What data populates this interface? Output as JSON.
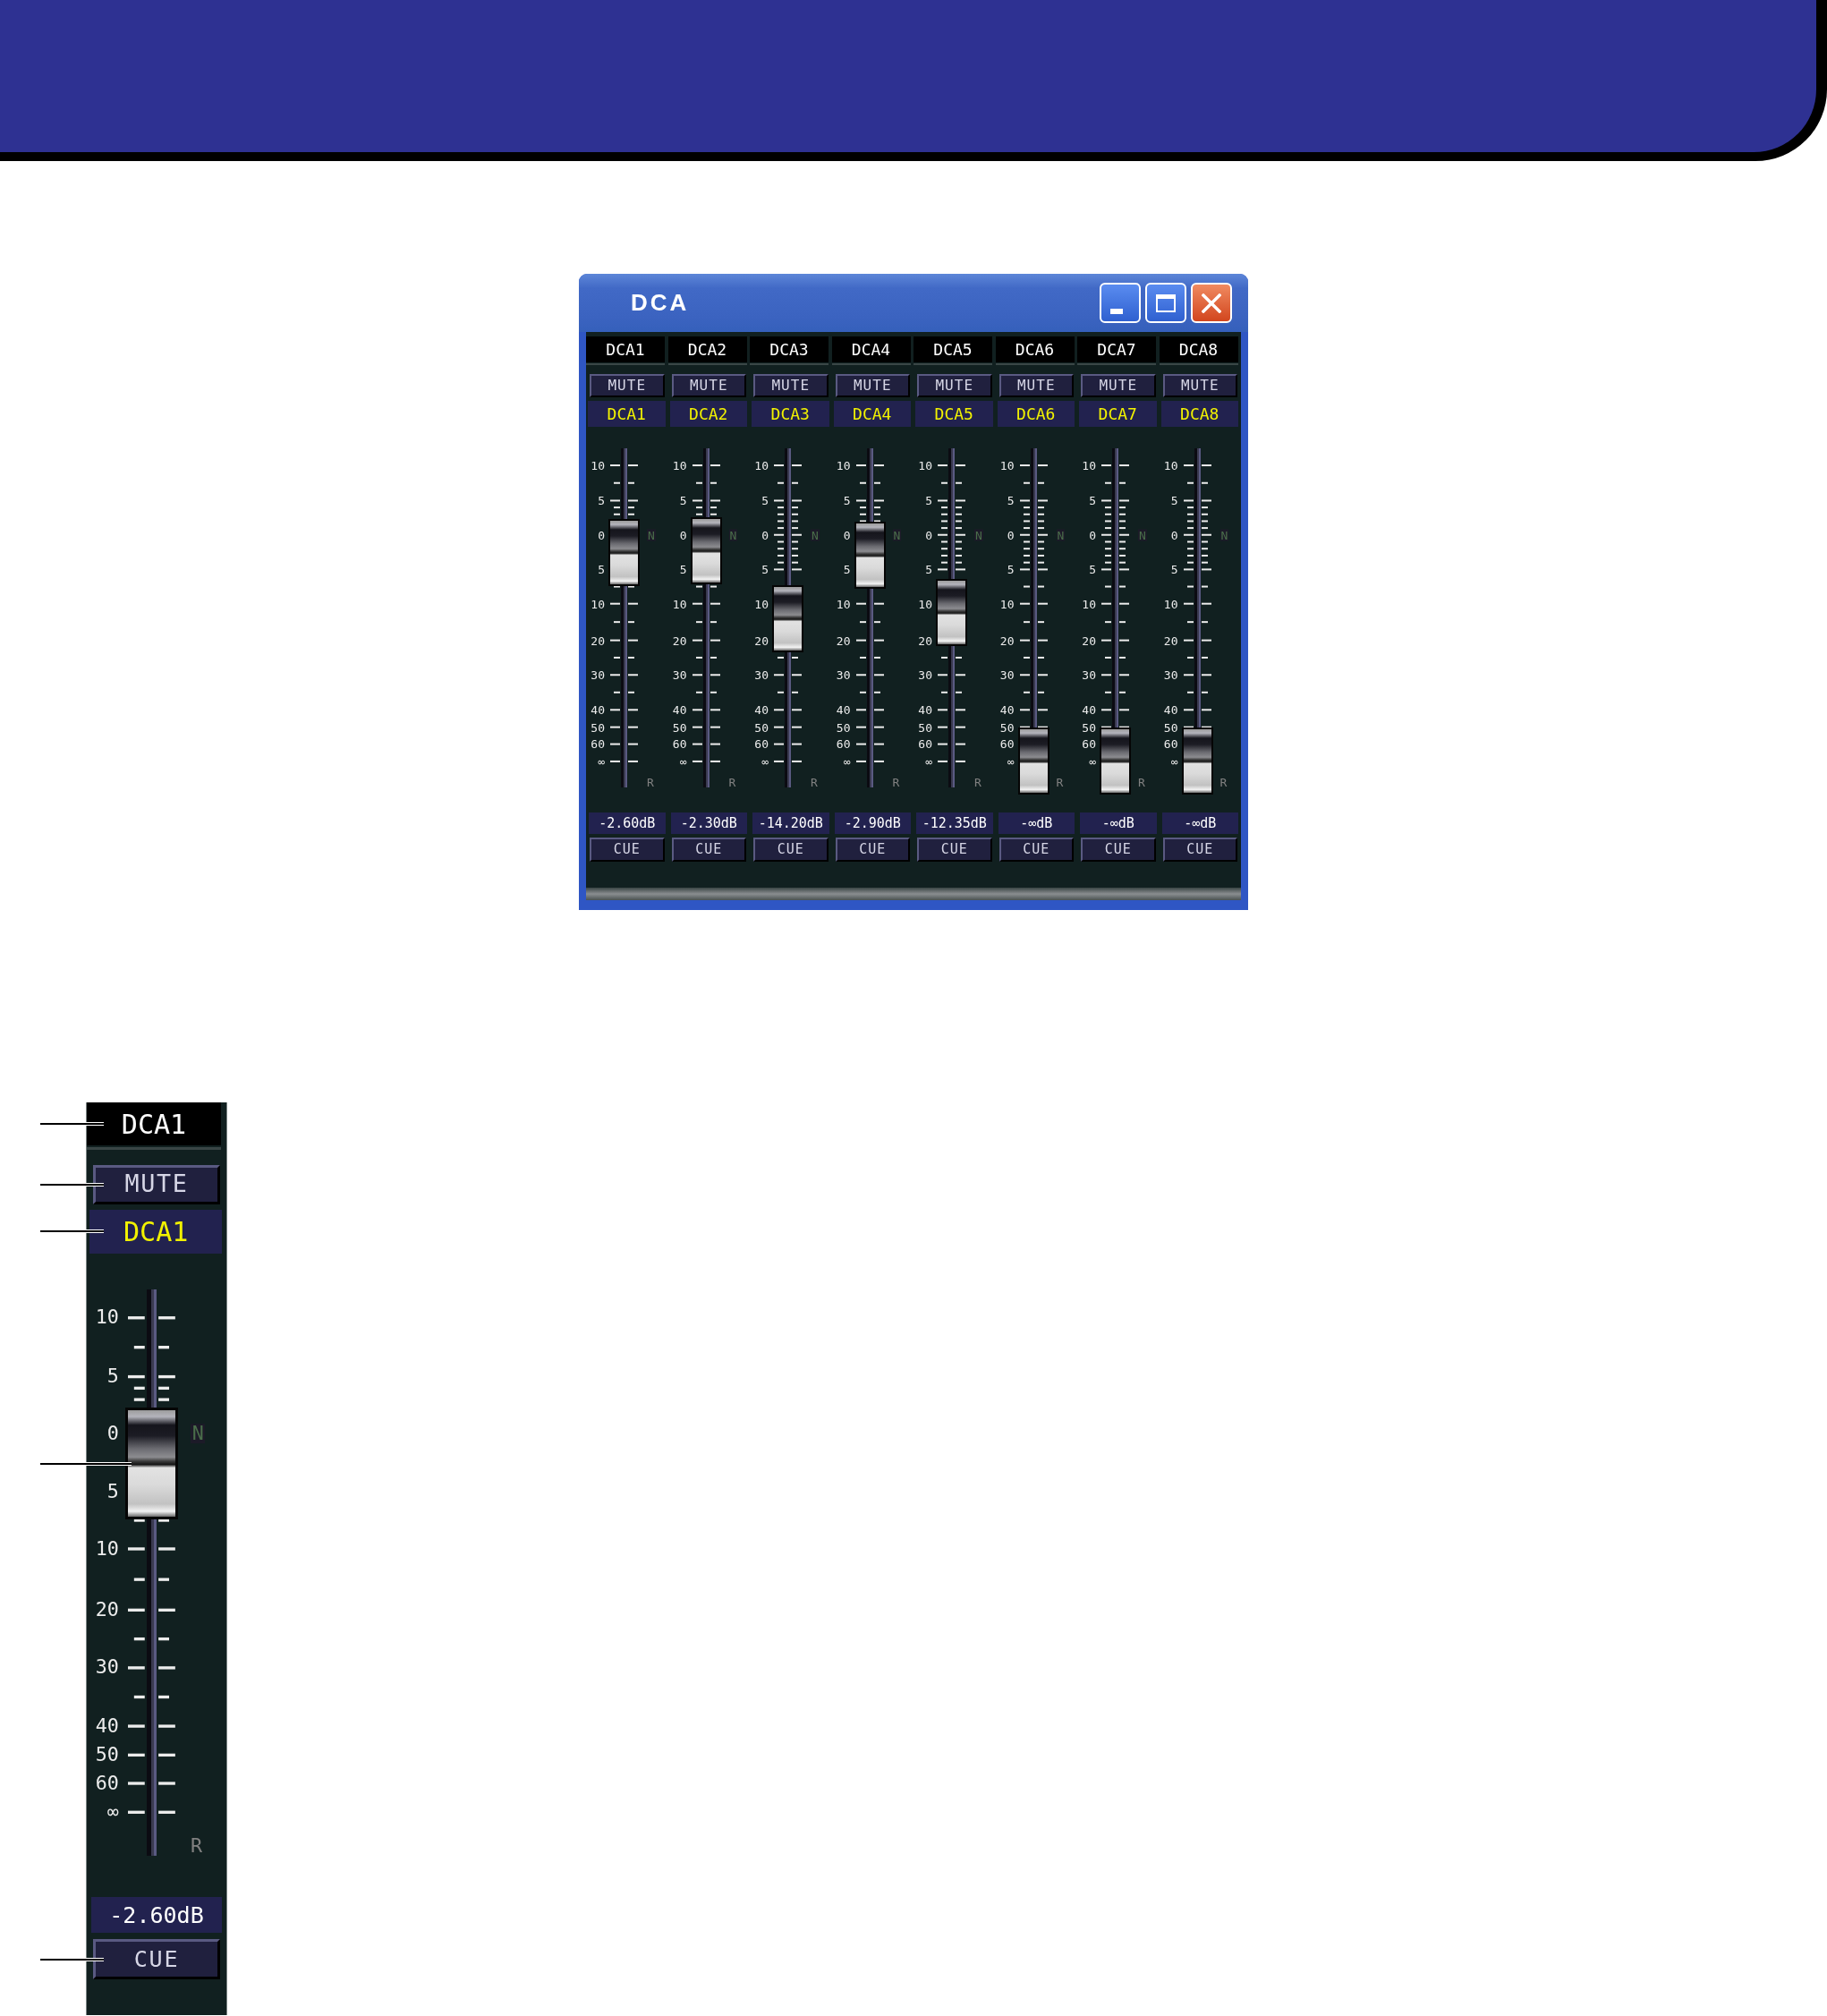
{
  "window": {
    "title": "DCA",
    "channels": [
      {
        "name": "DCA1",
        "mute": "MUTE",
        "label": "DCA1",
        "scale": [
          "10",
          "5",
          "0",
          "5",
          "10",
          "20",
          "30",
          "40",
          "50",
          "60",
          "∞"
        ],
        "nominal_mark": "N",
        "r_mark": "R",
        "level": 0.692,
        "reading": "-2.60dB",
        "cue": "CUE"
      },
      {
        "name": "DCA2",
        "mute": "MUTE",
        "label": "DCA2",
        "scale": [
          "10",
          "5",
          "0",
          "5",
          "10",
          "20",
          "30",
          "40",
          "50",
          "60",
          "∞"
        ],
        "nominal_mark": "N",
        "r_mark": "R",
        "level": 0.698,
        "reading": "-2.30dB",
        "cue": "CUE"
      },
      {
        "name": "DCA3",
        "mute": "MUTE",
        "label": "DCA3",
        "scale": [
          "10",
          "5",
          "0",
          "5",
          "10",
          "20",
          "30",
          "40",
          "50",
          "60",
          "∞"
        ],
        "nominal_mark": "N",
        "r_mark": "R",
        "level": 0.497,
        "reading": "-14.20dB",
        "cue": "CUE"
      },
      {
        "name": "DCA4",
        "mute": "MUTE",
        "label": "DCA4",
        "scale": [
          "10",
          "5",
          "0",
          "5",
          "10",
          "20",
          "30",
          "40",
          "50",
          "60",
          "∞"
        ],
        "nominal_mark": "N",
        "r_mark": "R",
        "level": 0.686,
        "reading": "-2.90dB",
        "cue": "CUE"
      },
      {
        "name": "DCA5",
        "mute": "MUTE",
        "label": "DCA5",
        "scale": [
          "10",
          "5",
          "0",
          "5",
          "10",
          "20",
          "30",
          "40",
          "50",
          "60",
          "∞"
        ],
        "nominal_mark": "N",
        "r_mark": "R",
        "level": 0.517,
        "reading": "-12.35dB",
        "cue": "CUE"
      },
      {
        "name": "DCA6",
        "mute": "MUTE",
        "label": "DCA6",
        "scale": [
          "10",
          "5",
          "0",
          "5",
          "10",
          "20",
          "30",
          "40",
          "50",
          "60",
          "∞"
        ],
        "nominal_mark": "N",
        "r_mark": "R",
        "level": 0.077,
        "reading": "-∞dB",
        "cue": "CUE"
      },
      {
        "name": "DCA7",
        "mute": "MUTE",
        "label": "DCA7",
        "scale": [
          "10",
          "5",
          "0",
          "5",
          "10",
          "20",
          "30",
          "40",
          "50",
          "60",
          "∞"
        ],
        "nominal_mark": "N",
        "r_mark": "R",
        "level": 0.077,
        "reading": "-∞dB",
        "cue": "CUE"
      },
      {
        "name": "DCA8",
        "mute": "MUTE",
        "label": "DCA8",
        "scale": [
          "10",
          "5",
          "0",
          "5",
          "10",
          "20",
          "30",
          "40",
          "50",
          "60",
          "∞"
        ],
        "nominal_mark": "N",
        "r_mark": "R",
        "level": 0.077,
        "reading": "-∞dB",
        "cue": "CUE"
      }
    ]
  },
  "detail_strip": {
    "name": "DCA1",
    "mute": "MUTE",
    "label": "DCA1",
    "scale": [
      "10",
      "5",
      "0",
      "5",
      "10",
      "20",
      "30",
      "40",
      "50",
      "60",
      "∞"
    ],
    "nominal_mark": "N",
    "r_mark": "R",
    "level": 0.692,
    "reading": "-2.60dB",
    "cue": "CUE"
  }
}
